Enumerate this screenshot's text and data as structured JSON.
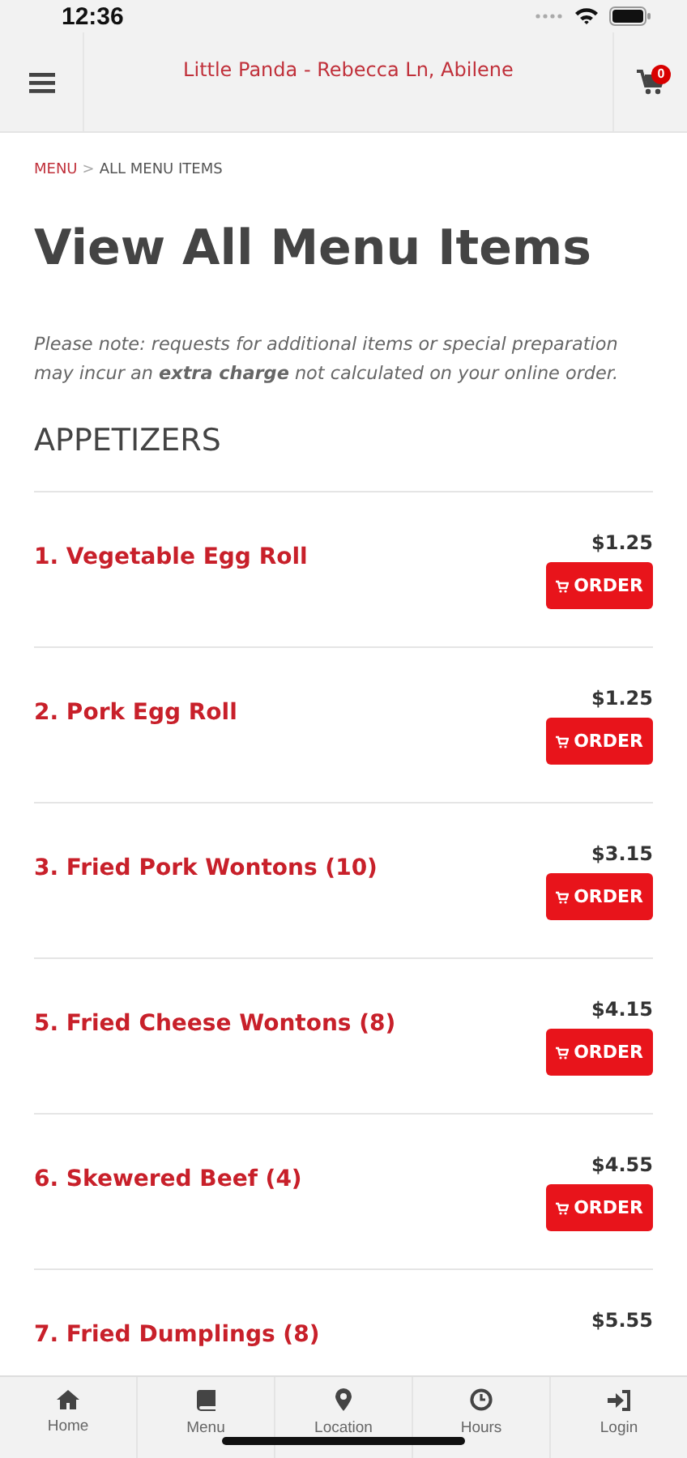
{
  "status_bar": {
    "time": "12:36"
  },
  "header": {
    "title": "Little Panda - Rebecca Ln, Abilene",
    "cart_count": "0"
  },
  "breadcrumb": {
    "link": "MENU",
    "separator": ">",
    "current": "ALL MENU ITEMS"
  },
  "page_title": "View All Menu Items",
  "note": "Please note: requests for additional items or special preparation may incur an **extra charge** not calculated on your online order.",
  "section": "APPETIZERS",
  "items": [
    {
      "name": "1. Vegetable Egg Roll",
      "price": "$1.25",
      "button": "ORDER"
    },
    {
      "name": "2. Pork Egg Roll",
      "price": "$1.25",
      "button": "ORDER"
    },
    {
      "name": "3. Fried Pork Wontons (10)",
      "price": "$3.15",
      "button": "ORDER"
    },
    {
      "name": "5. Fried Cheese Wontons (8)",
      "price": "$4.15",
      "button": "ORDER"
    },
    {
      "name": "6. Skewered Beef (4)",
      "price": "$4.55",
      "button": "ORDER"
    },
    {
      "name": "7. Fried Dumplings (8)",
      "price": "$5.55"
    }
  ],
  "bottom_nav": [
    {
      "label": "Home"
    },
    {
      "label": "Menu"
    },
    {
      "label": "Location"
    },
    {
      "label": "Hours"
    },
    {
      "label": "Login"
    }
  ]
}
